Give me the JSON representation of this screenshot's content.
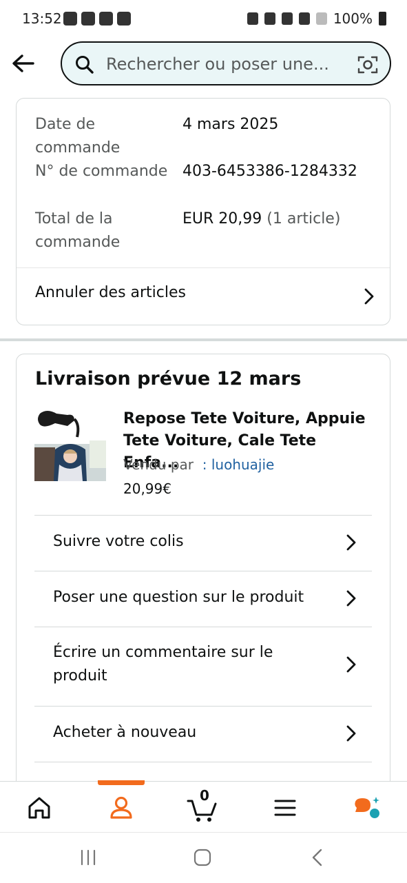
{
  "status_bar": {
    "time": "13:52",
    "battery": "100%"
  },
  "search": {
    "placeholder": "Rechercher ou poser une..."
  },
  "order_info": {
    "date_label": "Date de commande",
    "date_value": "4 mars 2025",
    "number_label": "N° de commande",
    "number_value": "403-6453386-1284332",
    "total_label": "Total de la commande",
    "total_value": "EUR 20,99",
    "total_count": "(1 article)",
    "cancel_label": "Annuler des articles"
  },
  "shipment": {
    "title": "Livraison prévue 12 mars",
    "product_title": "Repose Tete Voiture, Appuie Tete Voiture, Cale Tete Enfa...",
    "sold_by_label": "Vendu par",
    "seller": ": luohuajie",
    "price": "20,99€",
    "actions": [
      "Suivre votre colis",
      "Poser une question sur le produit",
      "Écrire un commentaire sur le produit",
      "Acheter à nouveau"
    ]
  },
  "bottom_nav": {
    "cart_count": "0",
    "accent_color": "#f26b1d",
    "icons": [
      "home-icon",
      "account-icon",
      "cart-icon",
      "menu-icon",
      "assistant-icon"
    ]
  }
}
